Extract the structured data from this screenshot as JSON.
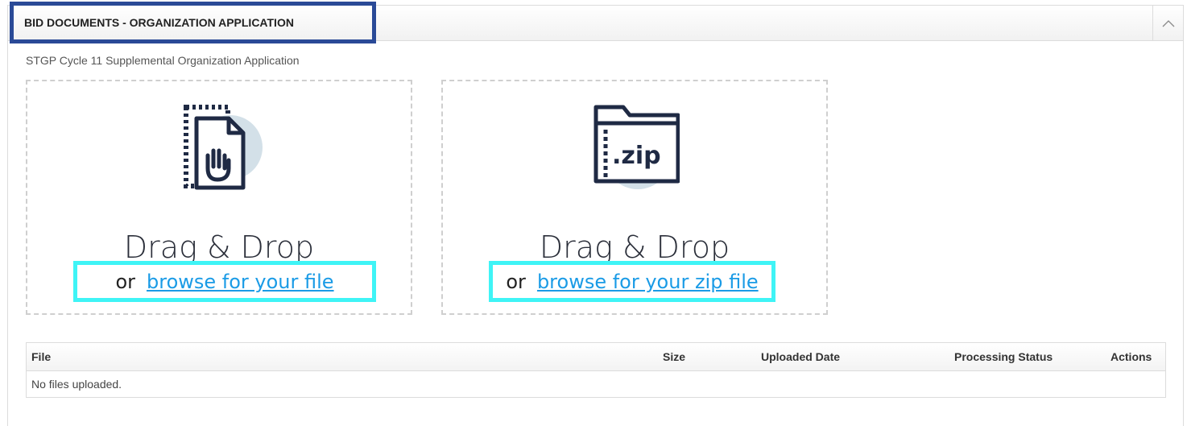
{
  "panel": {
    "title": "BID DOCUMENTS - ORGANIZATION APPLICATION",
    "subtitle": "STGP Cycle 11 Supplemental Organization Application",
    "collapse_icon": "chevron-up-icon"
  },
  "dropzones": [
    {
      "icon": "document-drag-icon",
      "main_text": "Drag & Drop",
      "or_text": "or",
      "link_text": "browse for your file"
    },
    {
      "icon": "zip-folder-icon",
      "icon_label": ".zip",
      "main_text": "Drag & Drop",
      "or_text": "or",
      "link_text": "browse for your zip file"
    }
  ],
  "files_table": {
    "columns": [
      "File",
      "Size",
      "Uploaded Date",
      "Processing Status",
      "Actions"
    ],
    "empty_message": "No files uploaded."
  },
  "colors": {
    "title_highlight": "#2a4a97",
    "link_highlight": "#3ff4f6",
    "link": "#1a9be6",
    "icon_dark": "#1f2a44",
    "icon_circle": "#d3e0e8"
  }
}
